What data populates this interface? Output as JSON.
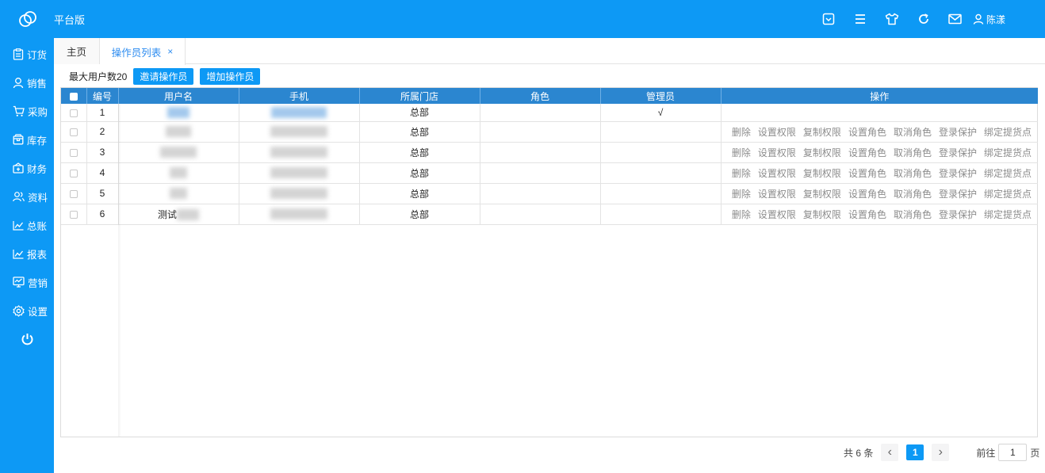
{
  "app": {
    "title": "平台版"
  },
  "header": {
    "icons": [
      "dropdown-box-icon",
      "menu-icon",
      "shirt-icon",
      "refresh-icon",
      "mail-icon"
    ],
    "user_name": "陈漾"
  },
  "sidebar": {
    "items": [
      {
        "label": "订货",
        "icon": "clipboard-icon"
      },
      {
        "label": "销售",
        "icon": "user-icon"
      },
      {
        "label": "采购",
        "icon": "cart-icon"
      },
      {
        "label": "库存",
        "icon": "box-icon"
      },
      {
        "label": "财务",
        "icon": "wallet-icon"
      },
      {
        "label": "资料",
        "icon": "users-icon"
      },
      {
        "label": "总账",
        "icon": "chart-icon"
      },
      {
        "label": "报表",
        "icon": "chart-icon"
      },
      {
        "label": "营销",
        "icon": "monitor-icon"
      },
      {
        "label": "设置",
        "icon": "gear-icon"
      }
    ]
  },
  "tabs": {
    "home": "主页",
    "active": "操作员列表",
    "close": "×"
  },
  "toolbar": {
    "max_users": "最大用户数20",
    "invite_label": "邀请操作员",
    "add_label": "增加操作员"
  },
  "table": {
    "headers": {
      "num": "编号",
      "username": "用户名",
      "phone": "手机",
      "store": "所属门店",
      "role": "角色",
      "admin": "管理员",
      "actions": "操作"
    },
    "rows": [
      {
        "num": "1",
        "username_visible": "",
        "store": "总部",
        "role": "",
        "admin": "√"
      },
      {
        "num": "2",
        "username_visible": "",
        "store": "总部",
        "role": "",
        "admin": ""
      },
      {
        "num": "3",
        "username_visible": "",
        "store": "总部",
        "role": "",
        "admin": ""
      },
      {
        "num": "4",
        "username_visible": "",
        "store": "总部",
        "role": "",
        "admin": ""
      },
      {
        "num": "5",
        "username_visible": "",
        "store": "总部",
        "role": "",
        "admin": ""
      },
      {
        "num": "6",
        "username_visible": "测试",
        "store": "总部",
        "role": "",
        "admin": ""
      }
    ],
    "row_actions": [
      "删除",
      "设置权限",
      "复制权限",
      "设置角色",
      "取消角色",
      "登录保护",
      "绑定提货点"
    ]
  },
  "pagination": {
    "total": "共 6 条",
    "prev": "‹",
    "current": "1",
    "next": "›",
    "goto_label": "前往",
    "goto_value": "1",
    "goto_unit": "页"
  }
}
